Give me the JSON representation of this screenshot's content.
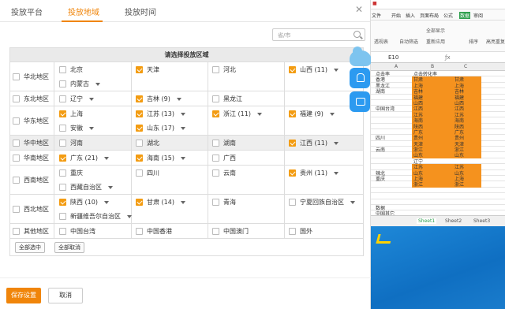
{
  "tabs": [
    "投放平台",
    "投放地域",
    "投放时间"
  ],
  "active_tab": 1,
  "search_placeholder": "省/市",
  "table_title": "请选择投放区域",
  "regions": [
    {
      "name": "华北地区",
      "gray": false,
      "checked": false,
      "lines": [
        [
          {
            "n": "北京",
            "c": false
          },
          {
            "n": "天津",
            "c": true
          },
          {
            "n": "河北",
            "c": false
          },
          {
            "n": "山西 (11)",
            "c": true,
            "dd": true
          }
        ],
        [
          {
            "n": "内蒙古",
            "c": false,
            "dd": true
          }
        ]
      ]
    },
    {
      "name": "东北地区",
      "gray": false,
      "checked": false,
      "lines": [
        [
          {
            "n": "辽宁",
            "c": false,
            "dd": true
          },
          {
            "n": "吉林 (9)",
            "c": true,
            "dd": true
          },
          {
            "n": "黑龙江",
            "c": false
          }
        ]
      ]
    },
    {
      "name": "华东地区",
      "gray": false,
      "checked": false,
      "lines": [
        [
          {
            "n": "上海",
            "c": true
          },
          {
            "n": "江苏 (13)",
            "c": true,
            "dd": true
          },
          {
            "n": "浙江 (11)",
            "c": true,
            "dd": true
          },
          {
            "n": "福建 (9)",
            "c": true,
            "dd": true
          }
        ],
        [
          {
            "n": "安徽",
            "c": false,
            "dd": true
          },
          {
            "n": "山东 (17)",
            "c": true,
            "dd": true
          }
        ]
      ]
    },
    {
      "name": "华中地区",
      "gray": true,
      "checked": false,
      "lines": [
        [
          {
            "n": "河南",
            "c": false
          },
          {
            "n": "湖北",
            "c": false
          },
          {
            "n": "湖南",
            "c": false
          },
          {
            "n": "江西 (11)",
            "c": true,
            "dd": true
          }
        ]
      ]
    },
    {
      "name": "华南地区",
      "gray": false,
      "checked": false,
      "lines": [
        [
          {
            "n": "广东 (21)",
            "c": true,
            "dd": true
          },
          {
            "n": "海南 (15)",
            "c": true,
            "dd": true
          },
          {
            "n": "广西",
            "c": false
          }
        ]
      ]
    },
    {
      "name": "西南地区",
      "gray": false,
      "checked": false,
      "lines": [
        [
          {
            "n": "重庆",
            "c": false
          },
          {
            "n": "四川",
            "c": false
          },
          {
            "n": "云南",
            "c": false
          },
          {
            "n": "贵州 (11)",
            "c": true,
            "dd": true
          }
        ],
        [
          {
            "n": "西藏自治区",
            "c": false,
            "dd": true
          }
        ]
      ]
    },
    {
      "name": "西北地区",
      "gray": false,
      "checked": false,
      "lines": [
        [
          {
            "n": "陕西 (10)",
            "c": true,
            "dd": true
          },
          {
            "n": "甘肃 (14)",
            "c": true,
            "dd": true
          },
          {
            "n": "青海",
            "c": false
          },
          {
            "n": "宁夏回族自治区",
            "c": false,
            "dd": true
          }
        ],
        [
          {
            "n": "新疆维吾尔自治区",
            "c": false,
            "dd": true
          }
        ]
      ]
    },
    {
      "name": "其他地区",
      "gray": false,
      "checked": false,
      "lines": [
        [
          {
            "n": "中国台湾",
            "c": false
          },
          {
            "n": "中国香港",
            "c": false
          },
          {
            "n": "中国澳门",
            "c": false
          },
          {
            "n": "国外",
            "c": false
          }
        ]
      ]
    }
  ],
  "select_all_label": "全部选中",
  "deselect_all_label": "全部取消",
  "save_label": "保存设置",
  "cancel_label": "取消",
  "accent_color": "#f0850a",
  "spreadsheet": {
    "top_tabs": [
      "文件",
      "开始",
      "插入",
      "页面布局",
      "公式",
      "数据",
      "审阅"
    ],
    "active_tab": "数据",
    "tools": [
      "透视表",
      "自动筛选",
      "全部显示",
      "重新应用",
      "排序",
      "高亮重复"
    ],
    "cell_ref": "E10",
    "columns": [
      "A",
      "B",
      "C"
    ],
    "rows": [
      {
        "a": "点击率",
        "b": "点击转化率",
        "c": "",
        "o": false
      },
      {
        "a": "香港",
        "b": "甘肃",
        "c": "甘肃",
        "o": true
      },
      {
        "a": "黑龙江",
        "b": "上海",
        "c": "上海",
        "o": true
      },
      {
        "a": "湖南",
        "b": "吉林",
        "c": "吉林",
        "o": true
      },
      {
        "a": "",
        "b": "福建",
        "c": "福建",
        "o": true
      },
      {
        "a": "",
        "b": "山西",
        "c": "山西",
        "o": true
      },
      {
        "a": "中国台湾",
        "b": "江西",
        "c": "江西",
        "o": true
      },
      {
        "a": "",
        "b": "江苏",
        "c": "江苏",
        "o": true
      },
      {
        "a": "",
        "b": "海南",
        "c": "海南",
        "o": true
      },
      {
        "a": "",
        "b": "陕西",
        "c": "陕西",
        "o": true
      },
      {
        "a": "",
        "b": "广东",
        "c": "广东",
        "o": true
      },
      {
        "a": "四川",
        "b": "贵州",
        "c": "贵州",
        "o": true
      },
      {
        "a": "",
        "b": "天津",
        "c": "天津",
        "o": true
      },
      {
        "a": "云南",
        "b": "浙江",
        "c": "浙江",
        "o": true
      },
      {
        "a": "",
        "b": "山东",
        "c": "山东",
        "o": true
      },
      {
        "a": "",
        "b": "辽宁",
        "c": "",
        "o": false
      },
      {
        "a": "",
        "b": "江苏",
        "c": "江苏",
        "o": true
      },
      {
        "a": "辣北",
        "b": "山东",
        "c": "山东",
        "o": true
      },
      {
        "a": "重庆",
        "b": "上海",
        "c": "上海",
        "o": true
      },
      {
        "a": "",
        "b": "浙江",
        "c": "浙江",
        "o": true
      },
      {
        "a": "",
        "b": "",
        "c": "",
        "o": false
      },
      {
        "a": "",
        "b": "",
        "c": "",
        "o": false
      },
      {
        "a": "",
        "b": "",
        "c": "",
        "o": false
      },
      {
        "a": "数据",
        "b": "",
        "c": "",
        "o": false
      },
      {
        "a": "中国其它",
        "b": "",
        "c": "",
        "o": false
      }
    ],
    "sheets": [
      "Sheet1",
      "Sheet2",
      "Sheet3"
    ],
    "active_sheet": "Sheet1"
  }
}
